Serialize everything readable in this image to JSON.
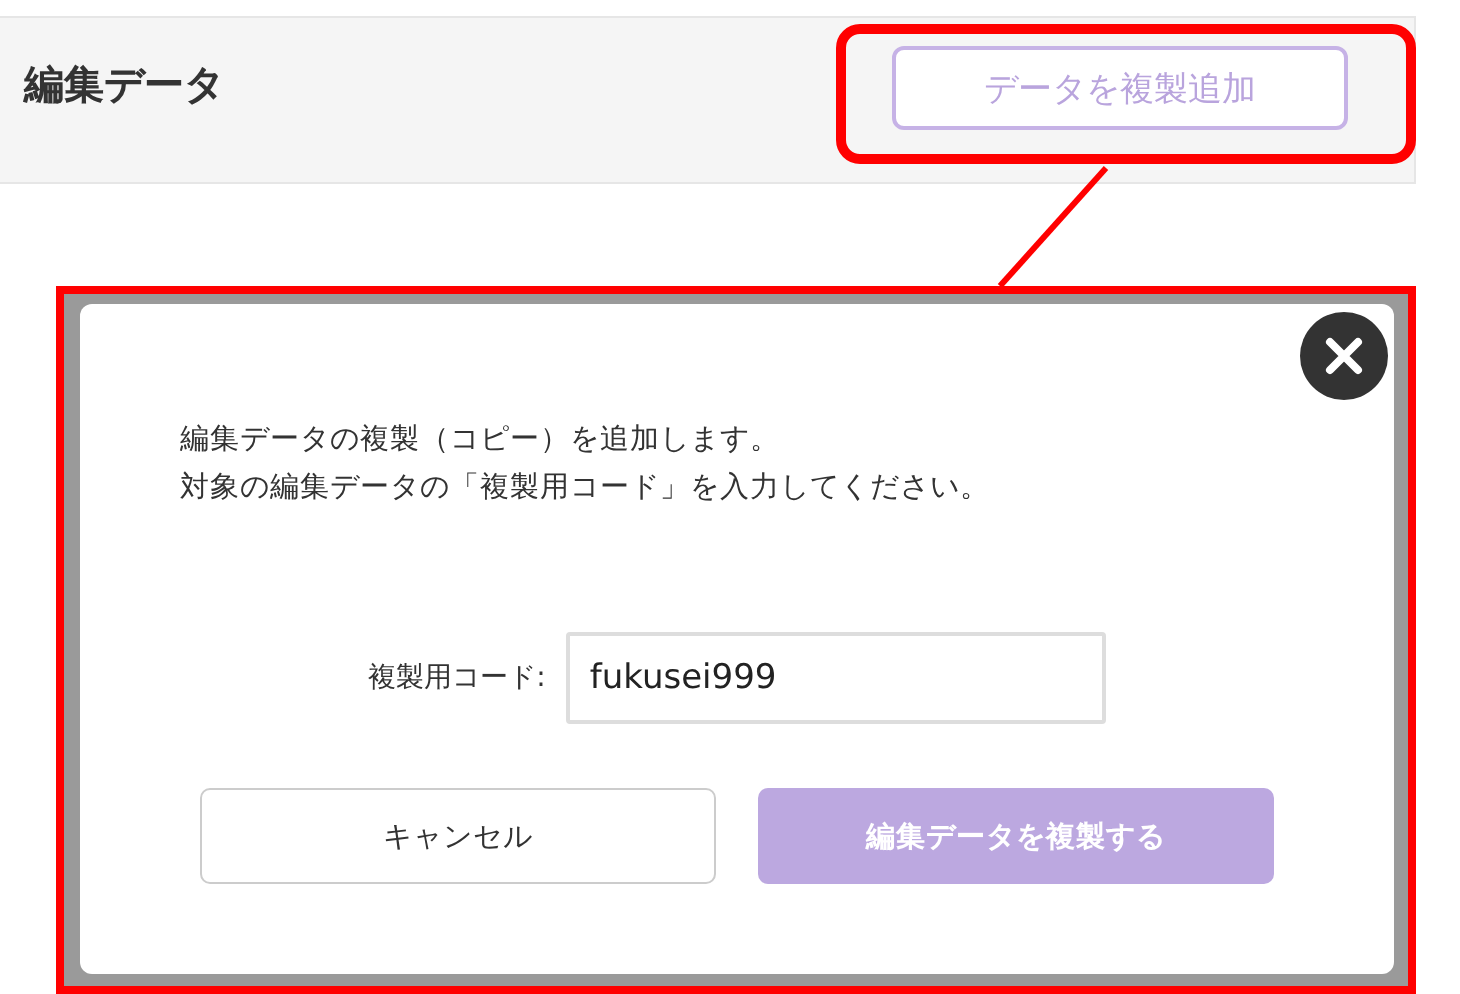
{
  "header": {
    "title": "編集データ",
    "button": "データを複製追加"
  },
  "dialog": {
    "message": [
      "編集データの複製（コピー）を追加します。",
      "対象の編集データの「複製用コード」を入力してください。"
    ],
    "field": {
      "label": "複製用コード:",
      "value": "fukusei999"
    },
    "buttons": [
      {
        "label": "キャンセル",
        "kind": "secondary"
      },
      {
        "label": "編集データを複製する",
        "kind": "primary"
      }
    ]
  }
}
